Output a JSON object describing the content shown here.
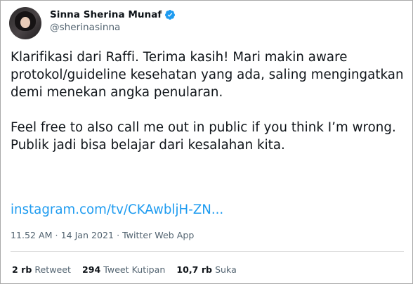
{
  "author": {
    "display_name": "Sinna Sherina Munaf",
    "handle": "@sherinasinna",
    "verified_icon": "verified-badge-icon",
    "verified_color": "#1d9bf0"
  },
  "tweet": {
    "paragraphs": [
      "Klarifikasi dari Raffi. Terima kasih! Mari makin aware protokol/guideline kesehatan yang ada, saling mengingatkan demi menekan angka penularan.",
      "Feel free to also call me out in public if you think I’m wrong. Publik jadi bisa belajar dari kesalahan kita."
    ],
    "link_text": "instagram.com/tv/CKAwbljH-ZN...",
    "time": "11.52 AM",
    "date": "14 Jan 2021",
    "source": "Twitter Web App",
    "separator": "·"
  },
  "stats": {
    "retweets": {
      "count": "2 rb",
      "label": "Retweet"
    },
    "quotes": {
      "count": "294",
      "label": "Tweet Kutipan"
    },
    "likes": {
      "count": "10,7 rb",
      "label": "Suka"
    }
  },
  "colors": {
    "link": "#1d9bf0",
    "secondary_text": "#536471",
    "primary_text": "#0f1419"
  }
}
